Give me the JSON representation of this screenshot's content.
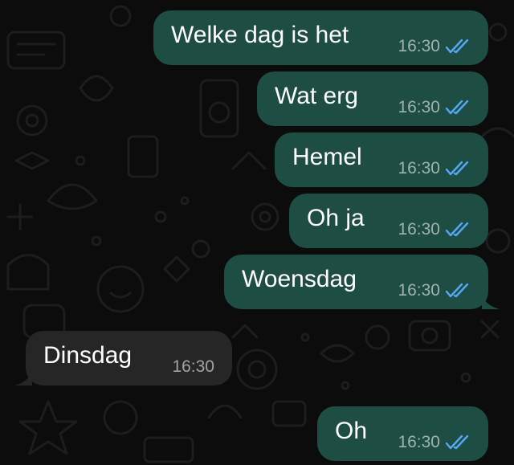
{
  "conversation": {
    "messages": [
      {
        "id": "m1",
        "direction": "outgoing",
        "text": "Welke dag is het",
        "time": "16:30",
        "status": "read-double-tick"
      },
      {
        "id": "m2",
        "direction": "outgoing",
        "text": "Wat erg",
        "time": "16:30",
        "status": "read-double-tick"
      },
      {
        "id": "m3",
        "direction": "outgoing",
        "text": "Hemel",
        "time": "16:30",
        "status": "read-double-tick"
      },
      {
        "id": "m4",
        "direction": "outgoing",
        "text": "Oh ja",
        "time": "16:30",
        "status": "read-double-tick"
      },
      {
        "id": "m5",
        "direction": "outgoing",
        "text": "Woensdag",
        "time": "16:30",
        "status": "read-double-tick"
      },
      {
        "id": "m6",
        "direction": "incoming",
        "text": "Dinsdag",
        "time": "16:30"
      },
      {
        "id": "m7",
        "direction": "outgoing",
        "text": "Oh",
        "time": "16:30",
        "status": "read-double-tick"
      }
    ]
  },
  "colors": {
    "background": "#0c0c0c",
    "outgoing_bubble": "#1e4d43",
    "incoming_bubble": "#262626",
    "read_ticks": "#53a9f5",
    "doodle_lines": "#1d1d1d"
  }
}
